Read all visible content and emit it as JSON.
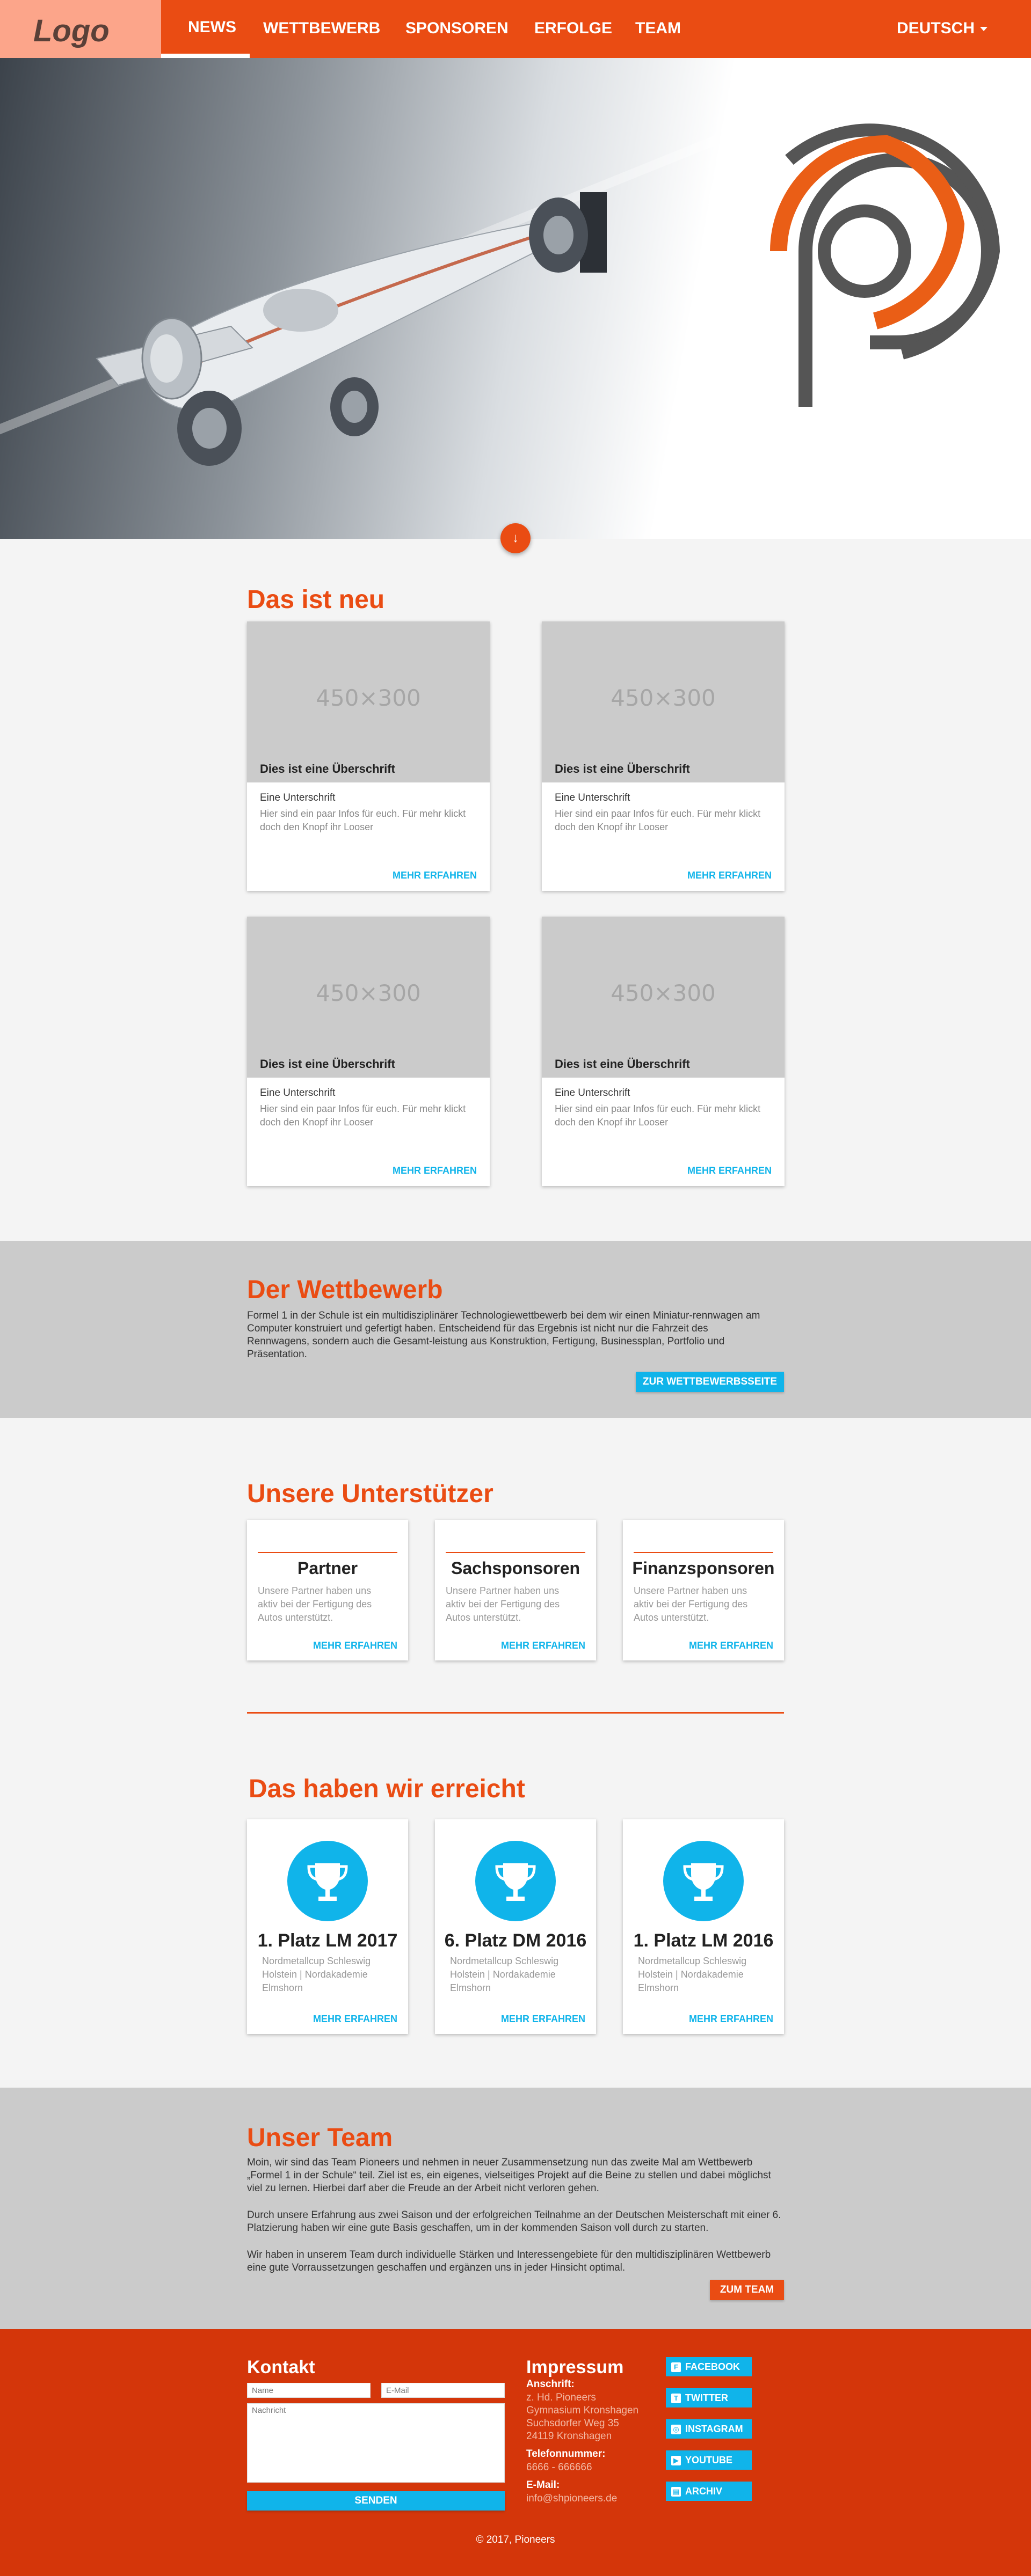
{
  "nav": {
    "logo": "Logo",
    "items": [
      "NEWS",
      "WETTBEWERB",
      "SPONSOREN",
      "ERFOLGE",
      "TEAM"
    ],
    "language": "DEUTSCH"
  },
  "hero": {
    "scroll_icon": "↓"
  },
  "news": {
    "title": "Das ist neu",
    "cards": [
      {
        "placeholder": "450×300",
        "heading": "Dies ist eine Überschrift",
        "subheading": "Eine Unterschrift",
        "text": "Hier sind ein paar Infos für euch. Für mehr klickt doch den Knopf ihr Looser",
        "link": "MEHR ERFAHREN"
      },
      {
        "placeholder": "450×300",
        "heading": "Dies ist eine Überschrift",
        "subheading": "Eine Unterschrift",
        "text": "Hier sind ein paar Infos für euch. Für mehr klickt doch den Knopf ihr Looser",
        "link": "MEHR ERFAHREN"
      },
      {
        "placeholder": "450×300",
        "heading": "Dies ist eine Überschrift",
        "subheading": "Eine Unterschrift",
        "text": "Hier sind ein paar Infos für euch. Für mehr klickt doch den Knopf ihr Looser",
        "link": "MEHR ERFAHREN"
      },
      {
        "placeholder": "450×300",
        "heading": "Dies ist eine Überschrift",
        "subheading": "Eine Unterschrift",
        "text": "Hier sind ein paar Infos für euch. Für mehr klickt doch den Knopf ihr Looser",
        "link": "MEHR ERFAHREN"
      }
    ]
  },
  "competition": {
    "title": "Der Wettbewerb",
    "text": "Formel 1 in der Schule ist ein multidisziplinärer Technologiewettbewerb bei dem wir einen Miniatur-rennwagen am Computer konstruiert und gefertigt haben. Entscheidend für das Ergebnis ist nicht nur die Fahrzeit des Rennwagens, sondern auch die Gesamt-leistung aus Konstruktion, Fertigung, Businessplan, Portfolio und Präsentation.",
    "button": "ZUR WETTBEWERBSSEITE"
  },
  "sponsors": {
    "title": "Unsere Unterstützer",
    "cards": [
      {
        "title": "Partner",
        "text": "Unsere Partner haben uns aktiv bei der Fertigung des Autos unterstützt.",
        "link": "MEHR ERFAHREN"
      },
      {
        "title": "Sachsponsoren",
        "text": "Unsere Partner haben uns aktiv bei der Fertigung des Autos unterstützt.",
        "link": "MEHR ERFAHREN"
      },
      {
        "title": "Finanzsponsoren",
        "text": "Unsere Partner haben uns aktiv bei der Fertigung des Autos unterstützt.",
        "link": "MEHR ERFAHREN"
      }
    ]
  },
  "achievements": {
    "title": "Das haben wir erreicht",
    "cards": [
      {
        "title": "1. Platz LM 2017",
        "text": "Nordmetallcup Schleswig Holstein | Nordakademie Elmshorn",
        "link": "MEHR ERFAHREN"
      },
      {
        "title": "6. Platz DM 2016",
        "text": "Nordmetallcup Schleswig Holstein | Nordakademie Elmshorn",
        "link": "MEHR ERFAHREN"
      },
      {
        "title": "1. Platz LM 2016",
        "text": "Nordmetallcup Schleswig Holstein | Nordakademie Elmshorn",
        "link": "MEHR ERFAHREN"
      }
    ]
  },
  "team": {
    "title": "Unser Team",
    "paragraphs": [
      "Moin, wir sind das Team Pioneers und nehmen in neuer Zusammensetzung nun das zweite Mal am Wettbewerb „Formel 1 in der Schule“ teil. Ziel ist es, ein eigenes, vielseitiges Projekt auf die Beine zu stellen und dabei möglichst viel zu lernen. Hierbei darf aber die Freude an der Arbeit nicht verloren gehen.",
      "Durch unsere Erfahrung aus zwei Saison und der erfolgreichen Teilnahme an der Deutschen Meisterschaft mit einer 6. Platzierung haben wir eine gute Basis geschaffen, um in der kommenden Saison voll durch zu starten.",
      "Wir haben in unserem Team durch individuelle Stärken und Interessengebiete für den multidisziplinären Wettbewerb eine gute Vorraussetzungen geschaffen und ergänzen uns in jeder Hinsicht optimal."
    ],
    "button": "ZUM TEAM"
  },
  "footer": {
    "contact": {
      "title": "Kontakt",
      "name_placeholder": "Name",
      "email_placeholder": "E-Mail",
      "message_placeholder": "Nachricht",
      "send": "SENDEN"
    },
    "impressum": {
      "title": "Impressum",
      "address_label": "Anschrift:",
      "address_lines": [
        "z. Hd. Pioneers",
        "Gymnasium Kronshagen",
        "Suchsdorfer Weg 35",
        "24119 Kronshagen"
      ],
      "phone_label": "Telefonnummer:",
      "phone": "6666 - 666666",
      "email_label": "E-Mail:",
      "email": "info@shpioneers.de"
    },
    "social": [
      {
        "label": "FACEBOOK",
        "icon": "facebook-icon",
        "glyph": "f"
      },
      {
        "label": "TWITTER",
        "icon": "twitter-icon",
        "glyph": "t"
      },
      {
        "label": "INSTAGRAM",
        "icon": "instagram-icon",
        "glyph": "◎"
      },
      {
        "label": "YOUTUBE",
        "icon": "youtube-icon",
        "glyph": "▶"
      },
      {
        "label": "ARCHIV",
        "icon": "archive-icon",
        "glyph": "▤"
      }
    ],
    "copyright": "© 2017, Pioneers"
  },
  "colors": {
    "accent": "#ea4c13",
    "footer": "#d4360a",
    "link": "#10b4ea",
    "section_grey": "#cbcbcb"
  }
}
